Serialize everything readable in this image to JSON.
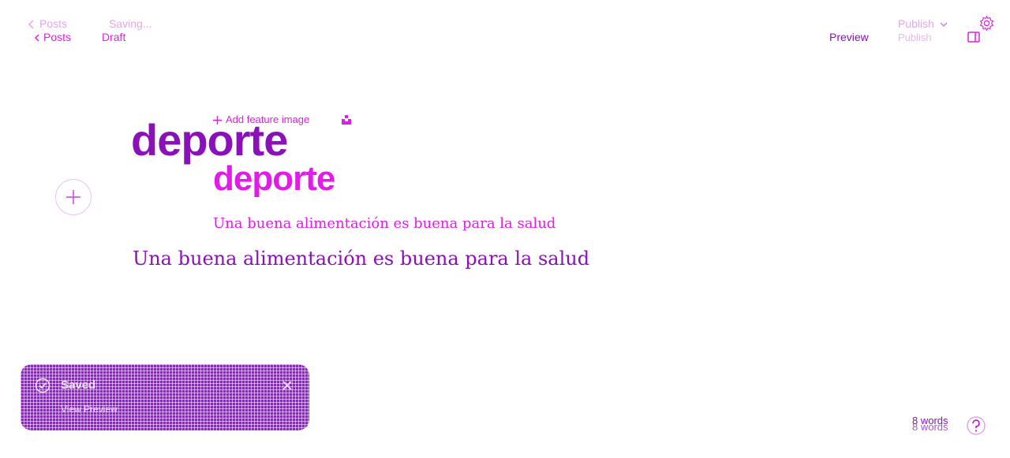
{
  "header": {
    "back_label_ghost": "Posts",
    "back_label": "Posts",
    "status_ghost": "Saving...",
    "status": "Draft",
    "preview_label": "Preview",
    "publish_label": "Publish",
    "publish_ghost": "Publish"
  },
  "editor": {
    "feature_image_label": "Add feature image",
    "title_large": "deporte",
    "title": "deporte",
    "excerpt": "Una buena alimentación es buena para la salud",
    "excerpt_large": "Una buena alimentación es buena para la salud"
  },
  "toast": {
    "title": "Saved",
    "link": "View Preview"
  },
  "footer": {
    "word_count_a": "8 words",
    "word_count_b": "8 words"
  },
  "colors": {
    "accent": "#e11ce6",
    "purple": "#8a10b8",
    "toast_bg": "#9a18e2"
  },
  "icons": [
    "chevron-left-icon",
    "chevron-down-icon",
    "gear-icon",
    "sidebar-toggle-icon",
    "plus-icon",
    "unsplash-icon",
    "check-circle-icon",
    "close-icon",
    "help-icon"
  ]
}
